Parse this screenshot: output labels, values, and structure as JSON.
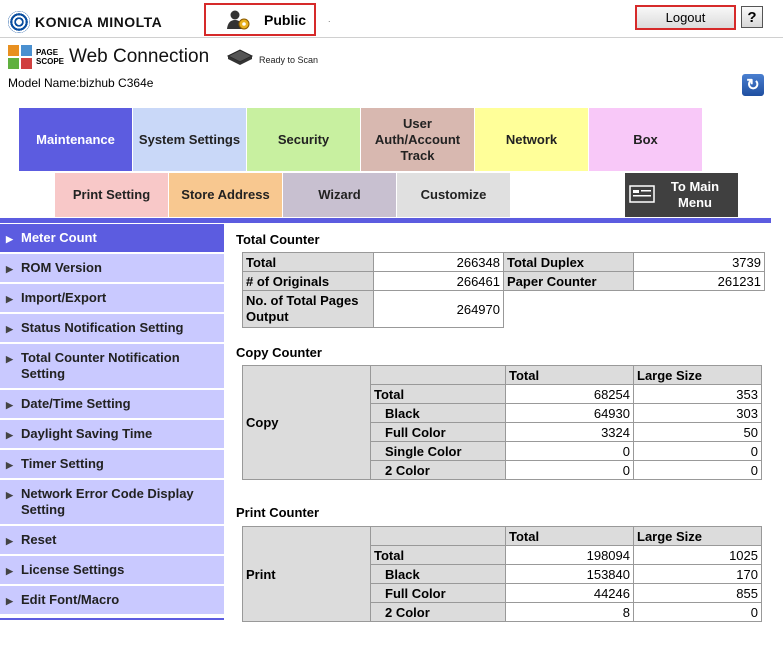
{
  "header": {
    "brand": "KONICA MINOLTA",
    "user_mode": "Public",
    "logout_label": "Logout",
    "help_label": "?",
    "app_small_line1": "PAGE",
    "app_small_line2": "SCOPE",
    "app_name": "Web Connection",
    "model_name": "Model Name:bizhub C364e",
    "status": "Ready to Scan",
    "dot": "."
  },
  "tabs_top": [
    {
      "label": "Maintenance",
      "color": "#5c5ce0",
      "active": true
    },
    {
      "label": "System Settings",
      "color": "#c9d8f8"
    },
    {
      "label": "Security",
      "color": "#c8f0a0"
    },
    {
      "label": "User Auth/Account Track",
      "color": "#d8b8b0"
    },
    {
      "label": "Network",
      "color": "#ffff99"
    },
    {
      "label": "Box",
      "color": "#f8c8f8"
    }
  ],
  "tabs_bottom": [
    {
      "label": "Print Setting",
      "color": "#f8c8c8"
    },
    {
      "label": "Store Address",
      "color": "#f8c890"
    },
    {
      "label": "Wizard",
      "color": "#c8c0d0"
    },
    {
      "label": "Customize",
      "color": "#e0e0e0"
    }
  ],
  "to_main_menu": "To Main Menu",
  "nav": [
    {
      "label": "Meter Count",
      "active": true
    },
    {
      "label": "ROM Version"
    },
    {
      "label": "Import/Export"
    },
    {
      "label": "Status Notification Setting"
    },
    {
      "label": "Total Counter Notification Setting"
    },
    {
      "label": "Date/Time Setting"
    },
    {
      "label": "Daylight Saving Time"
    },
    {
      "label": "Timer Setting"
    },
    {
      "label": "Network Error Code Display Setting"
    },
    {
      "label": "Reset"
    },
    {
      "label": "License Settings"
    },
    {
      "label": "Edit Font/Macro"
    }
  ],
  "total_counter": {
    "title": "Total Counter",
    "total_label": "Total",
    "total_value": "266348",
    "duplex_label": "Total Duplex",
    "duplex_value": "3739",
    "originals_label": "# of Originals",
    "originals_value": "266461",
    "paper_label": "Paper Counter",
    "paper_value": "261231",
    "pages_label": "No. of Total Pages Output",
    "pages_value": "264970"
  },
  "copy_counter": {
    "title": "Copy Counter",
    "group": "Copy",
    "col_total": "Total",
    "col_large": "Large Size",
    "rows": [
      {
        "label": "Total",
        "total": "68254",
        "large": "353"
      },
      {
        "label": "Black",
        "total": "64930",
        "large": "303"
      },
      {
        "label": "Full Color",
        "total": "3324",
        "large": "50"
      },
      {
        "label": "Single Color",
        "total": "0",
        "large": "0"
      },
      {
        "label": "2 Color",
        "total": "0",
        "large": "0"
      }
    ]
  },
  "print_counter": {
    "title": "Print Counter",
    "group": "Print",
    "col_total": "Total",
    "col_large": "Large Size",
    "rows": [
      {
        "label": "Total",
        "total": "198094",
        "large": "1025"
      },
      {
        "label": "Black",
        "total": "153840",
        "large": "170"
      },
      {
        "label": "Full Color",
        "total": "44246",
        "large": "855"
      },
      {
        "label": "2 Color",
        "total": "8",
        "large": "0"
      }
    ]
  }
}
